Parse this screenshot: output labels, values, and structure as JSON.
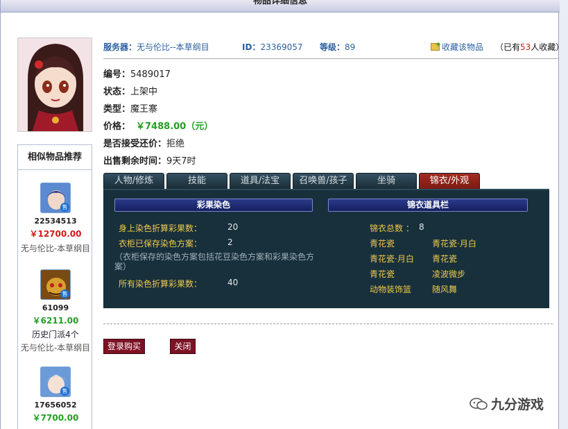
{
  "page": {
    "title": "物品详细信息"
  },
  "top": {
    "server_label": "服务器：",
    "server_value": "无与伦比--本草纲目",
    "id_label": "ID：",
    "id_value": "23369057",
    "level_label": "等级：",
    "level_value": "89",
    "favorite_link": "收藏该物品",
    "fav_count_prefix": "（已有",
    "fav_count": "53",
    "fav_count_suffix": "人收藏）"
  },
  "props": [
    {
      "label": "编号：",
      "value": "5489017"
    },
    {
      "label": "状态：",
      "value": "上架中"
    },
    {
      "label": "类型：",
      "value": "魔王寨"
    },
    {
      "label": "价格：",
      "value": "￥7488.00（元）"
    },
    {
      "label": "是否接受还价：",
      "value": "拒绝"
    },
    {
      "label": "出售剩余时间：",
      "value": "9天7时"
    }
  ],
  "tabs": [
    "人物/修炼",
    "技能",
    "道具/法宝",
    "召唤兽/孩子",
    "坐骑",
    "锦衣/外观"
  ],
  "active_tab": 5,
  "panel": {
    "left_header": "彩果染色",
    "right_header": "锦衣道具栏",
    "dye_rows": [
      {
        "label": "身上染色折算彩果数：",
        "value": "20"
      },
      {
        "label": "衣柜已保存染色方案：",
        "value": "2"
      }
    ],
    "dye_note": "（衣柜保存的染色方案包括花豆染色方案和彩果染色方案）",
    "dye_total": {
      "label": "所有染色折算彩果数：",
      "value": "40"
    },
    "outfit_total_label": "锦衣总数 ：",
    "outfit_total_value": "8",
    "outfits": [
      {
        "a": "青花瓷",
        "b": "青花瓷·月白"
      },
      {
        "a": "青花瓷·月白",
        "b": "青花瓷"
      },
      {
        "a": "青花瓷",
        "b": "凌波微步"
      },
      {
        "a": "动物装饰篮",
        "b": "随风舞"
      }
    ]
  },
  "buttons": {
    "buy": "登录购买",
    "close": "关闭"
  },
  "sidebar": {
    "title": "相似物品推荐",
    "sell_badge": "售",
    "items": [
      {
        "id": "22534513",
        "price": "￥12700.00",
        "price_color": "#d21a1a",
        "server": "无与伦比-本草纲目",
        "extra": ""
      },
      {
        "id": "61099",
        "price": "￥6211.00",
        "price_color": "#22a022",
        "server": "无与伦比-本草纲目",
        "extra": "历史门派4个"
      },
      {
        "id": "17656052",
        "price": "￥7700.00",
        "price_color": "#22a022",
        "server": "",
        "extra": ""
      }
    ]
  },
  "watermark": "九分游戏",
  "colors": {
    "accent_blue": "#2a5f9e",
    "price_green": "#22a022",
    "price_red": "#d21a1a",
    "panel_bg": "#17303c",
    "active_tab": "#a32c22"
  }
}
